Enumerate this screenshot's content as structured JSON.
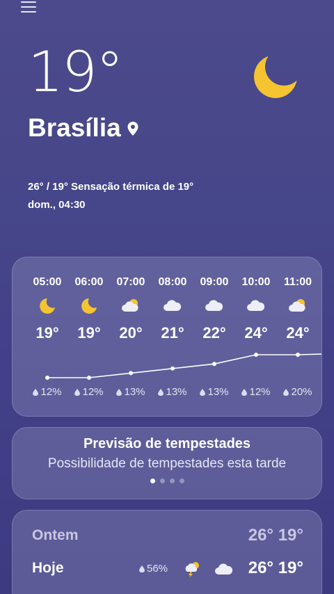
{
  "header": {
    "menu_icon": "hamburger-menu-icon",
    "current_temp": "19°",
    "condition_icon": "crescent-moon-icon",
    "city": "Brasília",
    "location_icon": "map-pin-icon",
    "summary_line1": "26° / 19° Sensação térmica de 19°",
    "summary_line2": "dom., 04:30"
  },
  "colors": {
    "moon": "#f5c430",
    "background_top": "#4c4a8c",
    "background_bottom": "#3d3a80"
  },
  "hourly": [
    {
      "time": "05:00",
      "icon": "moon-icon",
      "temp": "19°",
      "temp_value": 19,
      "precip": "12%"
    },
    {
      "time": "06:00",
      "icon": "moon-icon",
      "temp": "19°",
      "temp_value": 19,
      "precip": "12%"
    },
    {
      "time": "07:00",
      "icon": "partly-cloudy-icon",
      "temp": "20°",
      "temp_value": 20,
      "precip": "13%"
    },
    {
      "time": "08:00",
      "icon": "cloud-icon",
      "temp": "21°",
      "temp_value": 21,
      "precip": "13%"
    },
    {
      "time": "09:00",
      "icon": "cloud-icon",
      "temp": "22°",
      "temp_value": 22,
      "precip": "13%"
    },
    {
      "time": "10:00",
      "icon": "cloud-icon",
      "temp": "24°",
      "temp_value": 24,
      "precip": "12%"
    },
    {
      "time": "11:00",
      "icon": "partly-cloudy-icon",
      "temp": "24°",
      "temp_value": 24,
      "precip": "20%"
    }
  ],
  "storm_card": {
    "title": "Previsão de tempestades",
    "subtitle": "Possibilidade de tempestades esta tarde",
    "pages": 4,
    "active_page": 1
  },
  "daily": {
    "yesterday": {
      "label": "Ontem",
      "high": "26°",
      "low": "19°"
    },
    "today": {
      "label": "Hoje",
      "precip": "56%",
      "icon_day": "thunderstorm-sun-icon",
      "icon_night": "cloud-icon",
      "high": "26°",
      "low": "19°"
    }
  }
}
